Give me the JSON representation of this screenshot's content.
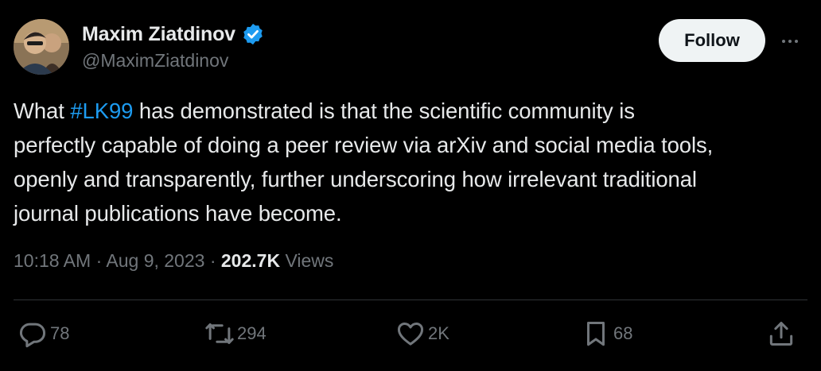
{
  "author": {
    "name": "Maxim Ziatdinov",
    "handle": "@MaximZiatdinov",
    "verified": true
  },
  "follow_button": {
    "label": "Follow"
  },
  "tweet": {
    "lines": [
      {
        "prefix": "What ",
        "hashtag": "#LK99",
        "suffix": " has demonstrated is that the scientific community is"
      },
      {
        "text": "perfectly capable of doing a peer review via arXiv and social media tools,"
      },
      {
        "text": "openly and transparently, further underscoring how irrelevant traditional"
      },
      {
        "text": "journal publications have become."
      }
    ]
  },
  "meta": {
    "time": "10:18 AM",
    "date": "Aug 9, 2023",
    "views_count": "202.7K",
    "views_label": "Views",
    "separator": "·"
  },
  "actions": {
    "reply": {
      "icon": "reply-icon",
      "count": "78"
    },
    "repost": {
      "icon": "repost-icon",
      "count": "294"
    },
    "like": {
      "icon": "heart-icon",
      "count": "2K"
    },
    "bookmark": {
      "icon": "bookmark-icon",
      "count": "68"
    },
    "share": {
      "icon": "share-icon"
    }
  },
  "colors": {
    "background": "#000000",
    "text": "#e7e9ea",
    "secondary": "#71767b",
    "accent": "#1d9bf0",
    "divider": "#2f3336",
    "follow_bg": "#eff3f4"
  }
}
